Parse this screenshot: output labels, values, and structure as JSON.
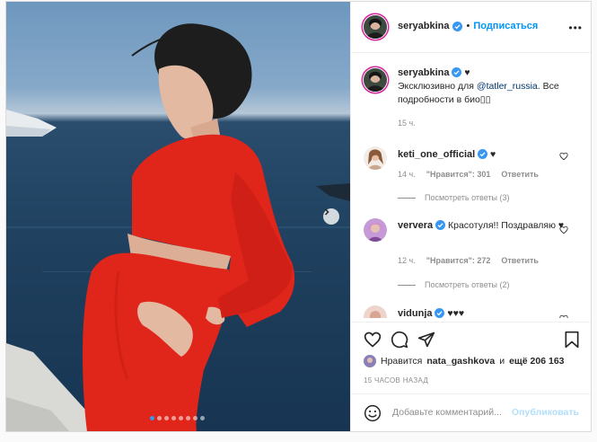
{
  "post": {
    "username": "seryabkina",
    "follow_label": "Подписаться",
    "more_label": "•••",
    "carousel": {
      "slide_count": 8,
      "active_index": 0
    }
  },
  "caption": {
    "username": "seryabkina",
    "heart": "♥",
    "text_before": "Эксклюзивно для ",
    "mention": "@tatler_russia",
    "text_after": ". Все подробности в био▯▯",
    "time": "15 ч."
  },
  "comments": [
    {
      "username": "keti_one_official",
      "text": "♥",
      "time": "14 ч.",
      "likes": "\"Нравится\": 301",
      "reply": "Ответить",
      "view_replies": "Посмотреть ответы (3)"
    },
    {
      "username": "ververa",
      "text": "Красотуля!! Поздравляю ♥",
      "time": "12 ч.",
      "likes": "\"Нравится\": 272",
      "reply": "Ответить",
      "view_replies": "Посмотреть ответы (2)"
    },
    {
      "username": "vidunja",
      "text": "♥♥♥"
    }
  ],
  "likes": {
    "prefix": "Нравится",
    "user": "nata_gashkova",
    "middle": "и",
    "rest": "ещё 206 163"
  },
  "time_ago": "15 ЧАСОВ НАЗАД",
  "add_comment": {
    "placeholder": "Добавьте комментарий...",
    "post_label": "Опубликовать"
  },
  "icons": {
    "more": "more-icon",
    "next": "chevron-right-icon",
    "heart": "heart-icon",
    "comment": "comment-icon",
    "share": "share-icon",
    "save": "bookmark-icon",
    "emoji": "emoji-icon",
    "verified": "verified-badge-icon"
  },
  "colors": {
    "accent": "#0095f6",
    "dress": "#e0251b",
    "verified": "#3897f0"
  }
}
